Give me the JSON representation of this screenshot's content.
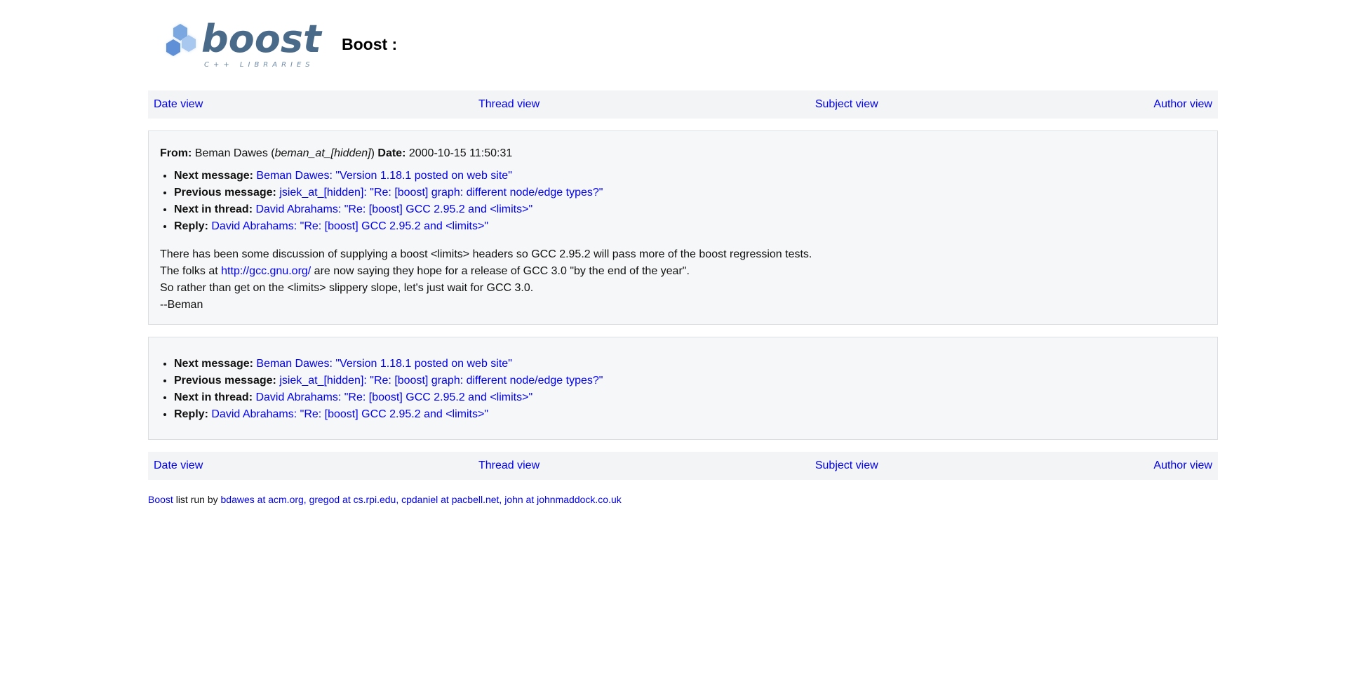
{
  "header": {
    "logo_word": "boost",
    "logo_sub": "C++ LIBRARIES",
    "title": "Boost :"
  },
  "nav": {
    "date_view": "Date view",
    "thread_view": "Thread view",
    "subject_view": "Subject view",
    "author_view": "Author view"
  },
  "message": {
    "from_label": "From:",
    "author_name": "Beman Dawes",
    "author_email": "beman_at_[hidden]",
    "open_paren": " (",
    "close_paren": ") ",
    "date_label": "Date:",
    "date_value": "2000-10-15 11:50:31",
    "body_line1": "There has been some discussion of supplying a boost <limits> headers so GCC 2.95.2 will pass more of the boost regression tests.",
    "body_line2_pre": "The folks at ",
    "body_line2_link": "http://gcc.gnu.org/",
    "body_line2_post": " are now saying they hope for a release of GCC 3.0 \"by the end of the year\".",
    "body_line3": "So rather than get on the <limits> slippery slope, let's just wait for GCC 3.0.",
    "body_line4": "--Beman"
  },
  "links": {
    "next_label": "Next message:",
    "next_value": "Beman Dawes: \"Version 1.18.1 posted on web site\"",
    "prev_label": "Previous message:",
    "prev_value": "jsiek_at_[hidden]: \"Re: [boost] graph: different node/edge types?\"",
    "next_thread_label": "Next in thread:",
    "next_thread_value": "David Abrahams: \"Re: [boost] GCC 2.95.2 and <limits>\"",
    "reply_label": "Reply:",
    "reply_value": "David Abrahams: \"Re: [boost] GCC 2.95.2 and <limits>\""
  },
  "credits": {
    "boost_link": "Boost",
    "run_by": " list run by ",
    "maintainers": "bdawes at acm.org, gregod at cs.rpi.edu, cpdaniel at pacbell.net, john at johnmaddock.co.uk"
  },
  "colors": {
    "link": "#0000ee",
    "nav_background": "#f3f4f5",
    "panel_background": "#f6f7f8",
    "panel_border": "#dcdfe2",
    "logo_text": "#4a6a8a",
    "logo_hex": "#7aa7e0"
  }
}
